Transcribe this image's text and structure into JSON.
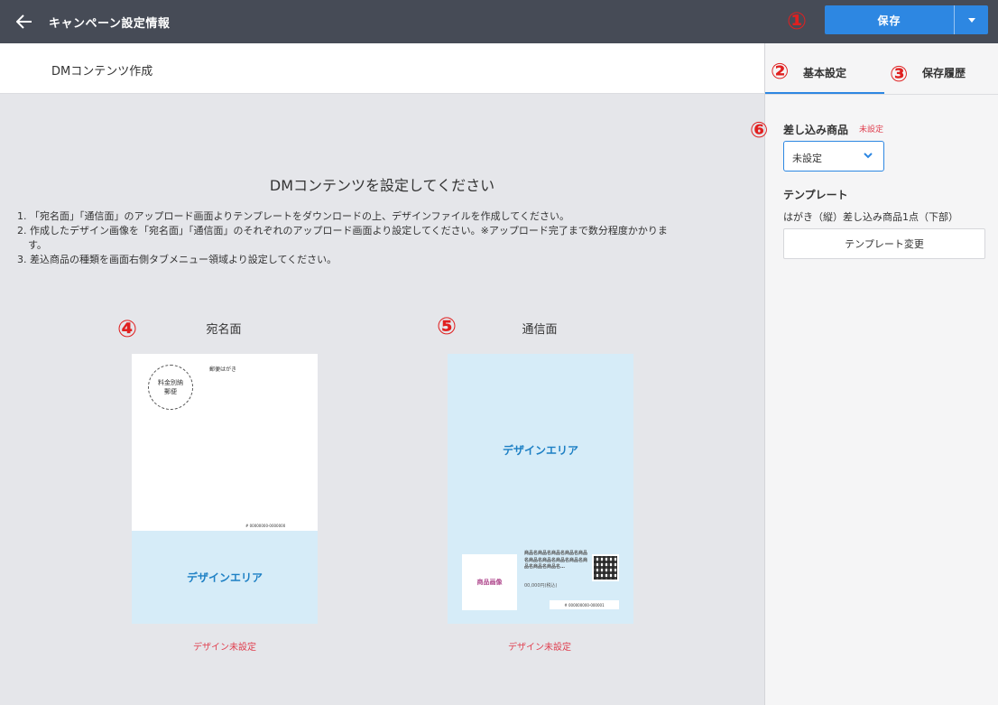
{
  "header": {
    "title": "キャンペーン設定情報",
    "save_label": "保存",
    "marker": "①"
  },
  "main": {
    "section_title": "DMコンテンツ作成",
    "heading": "DMコンテンツを設定してください",
    "instructions": [
      "1. 「宛名面」「通信面」のアップロード画面よりテンプレートをダウンロードの上、デザインファイルを作成してください。",
      "2. 作成したデザイン画像を「宛名面」「通信面」のそれぞれのアップロード画面より設定してください。※アップロード完了まで数分程度かかりま",
      "す。",
      "3. 差込商品の種類を画面右側タブメニュー領域より設定してください。"
    ],
    "faces": [
      {
        "marker": "④",
        "label": "宛名面",
        "postcard_label": "郵便はがき",
        "stamp_line1": "料金別納",
        "stamp_line2": "郵便",
        "barcode": "# 00000000-0000000",
        "design_area": "デザインエリア",
        "status": "デザイン未設定"
      },
      {
        "marker": "⑤",
        "label": "通信面",
        "design_area": "デザインエリア",
        "product_image": "商品画像",
        "product_text": "商品名商品名商品名商品名商品名商品名商品名商品名商品名商品名商品名商品名…",
        "price": "00,000円(税込)",
        "barcode": "# 000000000-000001",
        "status": "デザイン未設定"
      }
    ]
  },
  "panel": {
    "tabs": [
      {
        "marker": "②",
        "label": "基本設定",
        "active": true
      },
      {
        "marker": "③",
        "label": "保存履歴",
        "active": false
      }
    ],
    "insert_product": {
      "marker": "⑥",
      "label": "差し込み商品",
      "badge": "未設定",
      "selected": "未設定"
    },
    "template": {
      "label": "テンプレート",
      "name": "はがき（縦）差し込み商品1点（下部）",
      "change_button": "テンプレート変更"
    }
  },
  "colors": {
    "header_bg": "#464b56",
    "accent": "#2d87e2",
    "marker": "#e02020",
    "warning": "#e04050",
    "design_area_bg": "#d6ecf8"
  },
  "icons": {
    "back": "arrow-left-icon",
    "dropdown": "caret-down-icon",
    "select": "chevron-down-icon"
  }
}
